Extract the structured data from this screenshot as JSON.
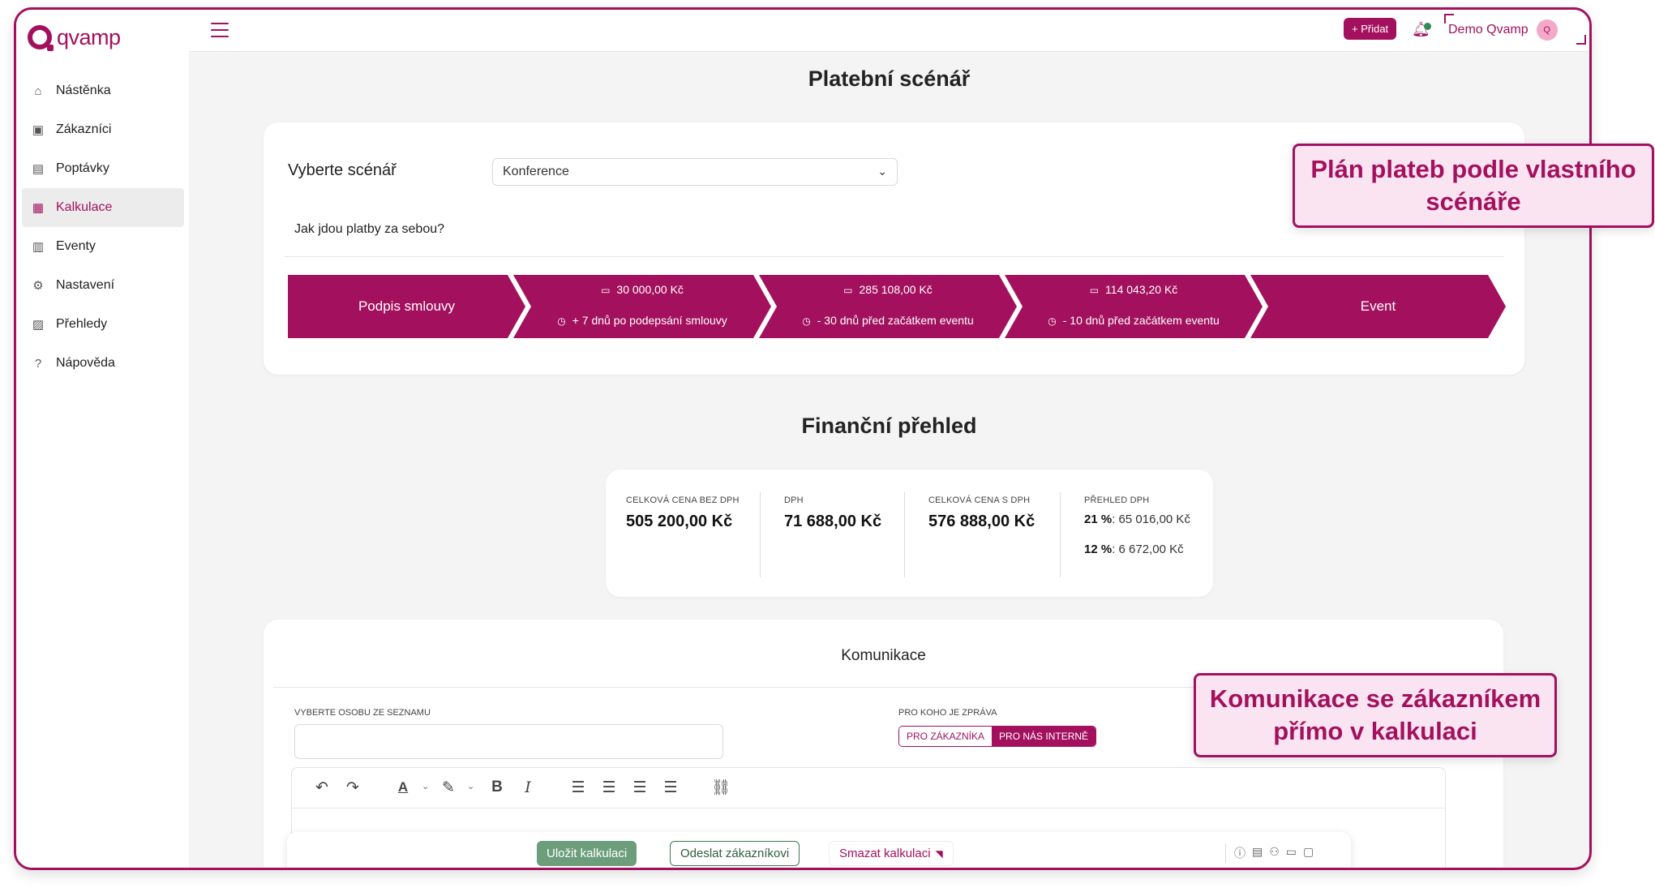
{
  "brand": {
    "name": "qvamp",
    "accent": "#a3115e"
  },
  "sidebar": {
    "items": [
      {
        "label": "Nástěnka",
        "icon": "home-icon",
        "glyph": "⌂"
      },
      {
        "label": "Zákazníci",
        "icon": "contacts-icon",
        "glyph": "▣"
      },
      {
        "label": "Poptávky",
        "icon": "document-icon",
        "glyph": "▤"
      },
      {
        "label": "Kalkulace",
        "icon": "calculator-icon",
        "glyph": "▦",
        "active": true
      },
      {
        "label": "Eventy",
        "icon": "calendar-icon",
        "glyph": "▥"
      },
      {
        "label": "Nastavení",
        "icon": "gear-icon",
        "glyph": "⚙"
      },
      {
        "label": "Přehledy",
        "icon": "chart-icon",
        "glyph": "▨"
      },
      {
        "label": "Nápověda",
        "icon": "help-icon",
        "glyph": "?"
      }
    ]
  },
  "topbar": {
    "add_label": "+ Přidat",
    "user_name": "Demo Qvamp",
    "avatar_initial": "Q"
  },
  "scenario": {
    "title": "Platební scénář",
    "select_label": "Vyberte scénář",
    "select_value": "Konference",
    "question": "Jak jdou platby za sebou?",
    "steps": [
      {
        "title": "Podpis smlouvy"
      },
      {
        "amount": "30 000,00 Kč",
        "term": "+ 7 dnů po podepsání smlouvy"
      },
      {
        "amount": "285 108,00 Kč",
        "term": "- 30 dnů před začátkem eventu"
      },
      {
        "amount": "114 043,20 Kč",
        "term": "- 10 dnů před začátkem eventu"
      },
      {
        "title": "Event"
      }
    ]
  },
  "finance": {
    "title": "Finanční přehled",
    "total_net_label": "Celková cena bez DPH",
    "total_net_value": "505 200,00 Kč",
    "vat_label": "DPH",
    "vat_value": "71 688,00 Kč",
    "total_gross_label": "Celková cena s DPH",
    "total_gross_value": "576 888,00 Kč",
    "vat_overview_label": "Přehled DPH",
    "rates": [
      {
        "rate": "21 %",
        "value": ": 65 016,00 Kč"
      },
      {
        "rate": "12 %",
        "value": ": 6 672,00 Kč"
      }
    ]
  },
  "communication": {
    "title": "Komunikace",
    "person_label": "Vyberte osobu ze seznamu",
    "recipient_label": "Pro koho je zpráva",
    "option_customer": "PRO ZÁKAZNÍKA",
    "option_internal": "PRO NÁS INTERNĚ"
  },
  "actions": {
    "save": "Uložit kalkulaci",
    "send": "Odeslat zákazníkovi",
    "delete": "Smazat kalkulaci"
  },
  "callouts": {
    "scenario": "Plán plateb podle vlastního scénáře",
    "communication": "Komunikace se zákazníkem přímo v kalkulaci"
  }
}
